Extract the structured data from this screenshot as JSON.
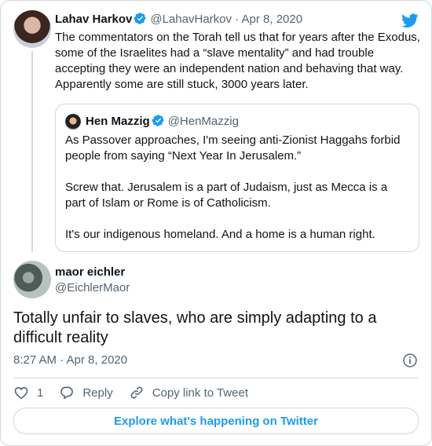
{
  "parent_tweet": {
    "author_name": "Lahav Harkov",
    "author_handle": "@LahavHarkov",
    "separator": "·",
    "date": "Apr 8, 2020",
    "text": "The commentators on the Torah tell us that for years after the Exodus, some of the Israelites had a “slave mentality” and had trouble accepting they were an independent nation and behaving that way. Apparently some are still stuck, 3000 years later."
  },
  "quoted_tweet": {
    "author_name": "Hen Mazzig",
    "author_handle": "@HenMazzig",
    "paragraphs": [
      "As Passover approaches, I'm seeing anti-Zionist Haggahs forbid people from saying “Next Year In Jerusalem.”",
      "Screw that. Jerusalem is a part of Judaism, just as Mecca is a part of Islam or Rome is of Catholicism.",
      "It's our indigenous homeland. And a home is a human right."
    ]
  },
  "reply_tweet": {
    "author_name": "maor eichler",
    "author_handle": "@EichlerMaor",
    "text": "Totally unfair to slaves, who are simply adapting to a difficult reality",
    "timestamp": "8:27 AM · Apr 8, 2020"
  },
  "actions": {
    "like_count": "1",
    "reply_label": "Reply",
    "copy_link_label": "Copy link to Tweet"
  },
  "explore_button_label": "Explore what's happening on Twitter",
  "icons": {
    "verified": "verified-badge-icon",
    "twitter": "twitter-bird-icon",
    "info": "info-icon",
    "like": "heart-icon",
    "reply": "speech-bubble-icon",
    "copy_link": "link-icon"
  },
  "colors": {
    "brand": "#1d9bf0",
    "text": "#0f1419",
    "secondary_text": "#536471",
    "border": "#cfd9de"
  }
}
